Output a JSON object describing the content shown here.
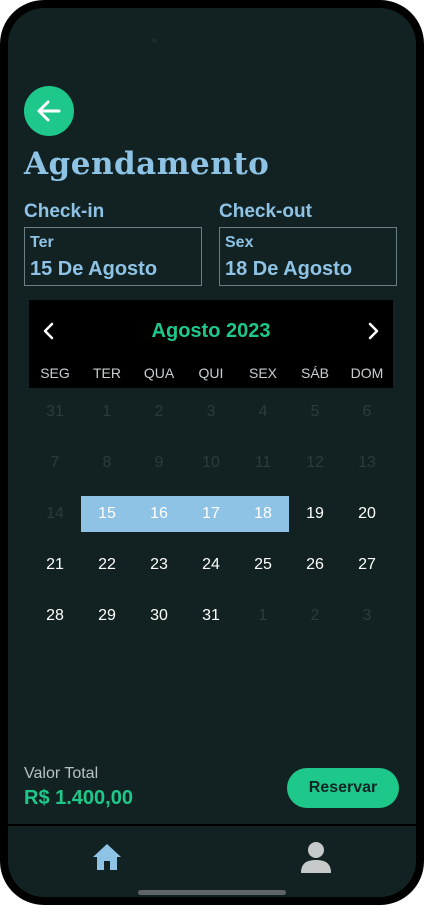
{
  "header": {
    "title": "Agendamento"
  },
  "checkin": {
    "label": "Check-in",
    "weekday": "Ter",
    "date": "15 De Agosto"
  },
  "checkout": {
    "label": "Check-out",
    "weekday": "Sex",
    "date": "18 De Agosto"
  },
  "calendar": {
    "month_label": "Agosto 2023",
    "weekdays": [
      "SEG",
      "TER",
      "QUA",
      "QUI",
      "SEX",
      "SÁB",
      "DOM"
    ],
    "weeks": [
      [
        "31",
        "1",
        "2",
        "3",
        "4",
        "5",
        "6"
      ],
      [
        "7",
        "8",
        "9",
        "10",
        "11",
        "12",
        "13"
      ],
      [
        "14",
        "15",
        "16",
        "17",
        "18",
        "19",
        "20"
      ],
      [
        "21",
        "22",
        "23",
        "24",
        "25",
        "26",
        "27"
      ],
      [
        "28",
        "29",
        "30",
        "31",
        "1",
        "2",
        "3"
      ]
    ]
  },
  "footer": {
    "total_label": "Valor Total",
    "total_value": "R$ 1.400,00",
    "reserve_label": "Reservar"
  },
  "colors": {
    "accent": "#1ec88a",
    "primary": "#8ec3e6",
    "background": "#122222"
  },
  "icons": {
    "back": "arrow-left-icon",
    "prev": "chevron-left-icon",
    "next": "chevron-right-icon",
    "home": "home-icon",
    "profile": "user-icon"
  }
}
